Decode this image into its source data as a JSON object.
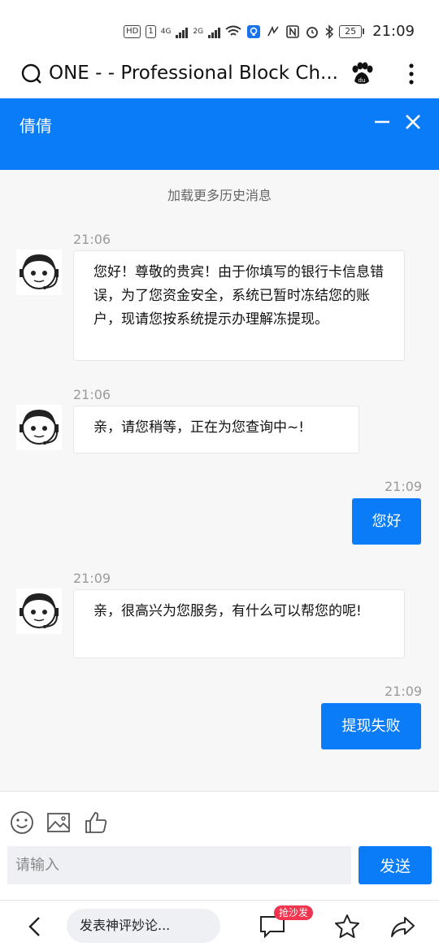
{
  "status_bar": {
    "hd_badge": "HD",
    "sim1": "1",
    "net1": "4G",
    "net2": "2G",
    "battery": "25",
    "time": "21:09"
  },
  "browser": {
    "title": "ONE - - Professional Block Ch...",
    "search_icon": "search-icon",
    "paw_icon": "baidu-paw-icon",
    "more_icon": "more-vertical-icon"
  },
  "chat_header": {
    "title": "倩倩"
  },
  "chat": {
    "load_more": "加载更多历史消息",
    "messages": [
      {
        "side": "in",
        "time": "21:06",
        "text": "您好！尊敬的贵宾！由于你填写的银行卡信息错误，为了您资金安全，系统已暂时冻结您的账户，现请您按系统提示办理解冻提现。"
      },
      {
        "side": "in",
        "time": "21:06",
        "text": "亲，请您稍等，正在为您查询中~!"
      },
      {
        "side": "out",
        "time": "21:09",
        "text": "您好"
      },
      {
        "side": "in",
        "time": "21:09",
        "text": "亲，很高兴为您服务，有什么可以帮您的呢!"
      },
      {
        "side": "out",
        "time": "21:09",
        "text": "提现失败"
      }
    ]
  },
  "input": {
    "placeholder": "请输入",
    "send_label": "发送",
    "tools": [
      "smiley-icon",
      "image-icon",
      "thumbs-up-icon"
    ]
  },
  "bottom_nav": {
    "comment_placeholder": "发表神评妙论...",
    "badge": "抢沙发"
  },
  "colors": {
    "accent": "#0a7cf8",
    "badge_red": "#f2354e"
  }
}
